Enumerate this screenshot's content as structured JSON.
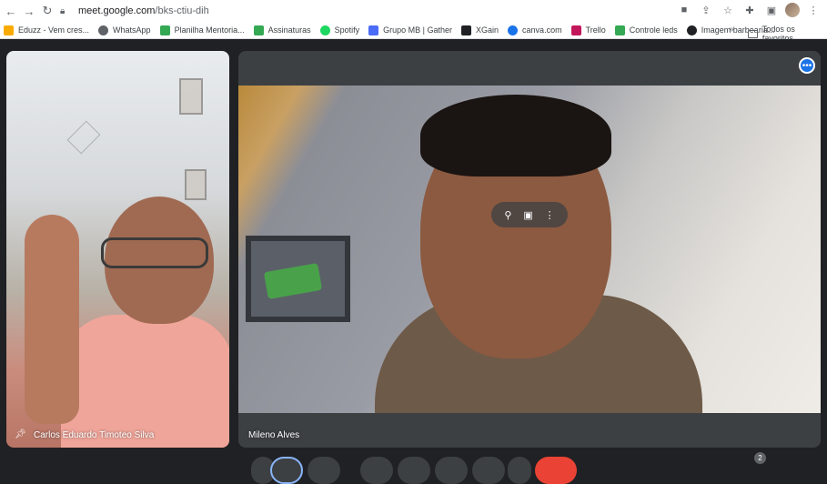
{
  "browser": {
    "url_host": "meet.google.com",
    "url_path": "/bks-ctiu-dih"
  },
  "bookmarks": [
    {
      "label": "Eduzz - Vem cres...",
      "color": "#f9ab00"
    },
    {
      "label": "WhatsApp",
      "color": "#5f6368"
    },
    {
      "label": "Planilha Mentoria...",
      "color": "#34a853"
    },
    {
      "label": "Assinaturas",
      "color": "#34a853"
    },
    {
      "label": "Spotify",
      "color": "#1ed760"
    },
    {
      "label": "Grupo MB | Gather",
      "color": "#4a6cf7"
    },
    {
      "label": "XGain",
      "color": "#202124"
    },
    {
      "label": "canva.com",
      "color": "#1a73e8"
    },
    {
      "label": "Trello",
      "color": "#c2185b"
    },
    {
      "label": "Controle leds",
      "color": "#34a853"
    },
    {
      "label": "Imagem barbearia...",
      "color": "#202124"
    }
  ],
  "bookmarks_overflow": "»",
  "bookmarks_folder": "Todos os favoritos",
  "meet": {
    "participant_left": "Carlos Eduardo Timoteo Silva",
    "participant_right": "Mileno Alves",
    "people_count": "2"
  }
}
